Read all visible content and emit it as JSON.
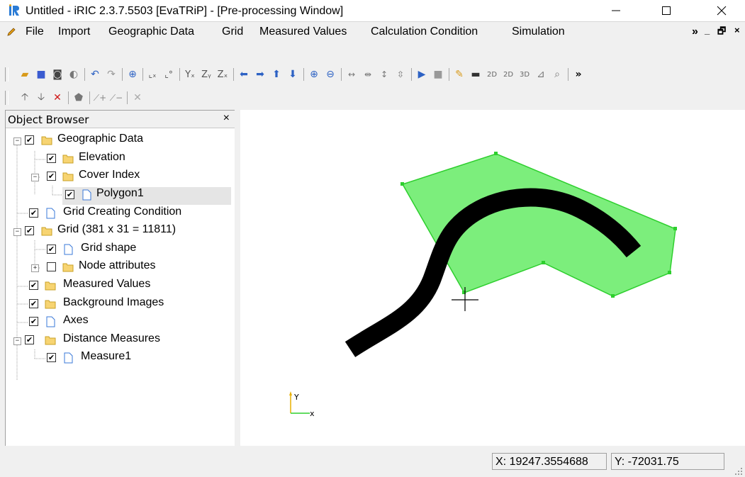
{
  "window": {
    "title": "Untitled - iRIC 2.3.7.5503 [EvaTRiP] - [Pre-processing Window]",
    "minimize_icon": "minimize-icon",
    "maximize_icon": "maximize-icon",
    "close_icon": "close-icon"
  },
  "menu": {
    "items": [
      "File",
      "Import",
      "Geographic Data",
      "Grid",
      "Measured Values",
      "Calculation Condition",
      "Simulation"
    ],
    "overflow": "»"
  },
  "object_browser": {
    "title": "Object Browser",
    "close": "×",
    "items": [
      {
        "label": "Geographic Data",
        "checked": true,
        "icon": "folder-icon"
      },
      {
        "label": "Elevation",
        "checked": true,
        "icon": "folder-icon"
      },
      {
        "label": "Cover Index",
        "checked": true,
        "icon": "folder-icon"
      },
      {
        "label": "Polygon1",
        "checked": true,
        "icon": "file-icon",
        "selected": true
      },
      {
        "label": "Grid Creating Condition",
        "checked": true,
        "icon": "file-icon"
      },
      {
        "label": "Grid (381 x 31 = 11811)",
        "checked": true,
        "icon": "folder-icon"
      },
      {
        "label": "Grid shape",
        "checked": true,
        "icon": "file-icon"
      },
      {
        "label": "Node attributes",
        "checked": false,
        "icon": "folder-icon"
      },
      {
        "label": "Measured Values",
        "checked": true,
        "icon": "folder-icon"
      },
      {
        "label": "Background Images",
        "checked": true,
        "icon": "folder-icon"
      },
      {
        "label": "Axes",
        "checked": true,
        "icon": "file-icon"
      },
      {
        "label": "Distance Measures",
        "checked": true,
        "icon": "folder-icon"
      },
      {
        "label": "Measure1",
        "checked": true,
        "icon": "file-icon"
      }
    ]
  },
  "canvas": {
    "axis_y": "Y",
    "axis_x": "x",
    "polygon_color": "#7cee7c",
    "polygon_edge": "#2ecf2e",
    "grid_color": "#000000"
  },
  "status": {
    "x": "X: 19247.3554688",
    "y": "Y: -72031.75"
  }
}
